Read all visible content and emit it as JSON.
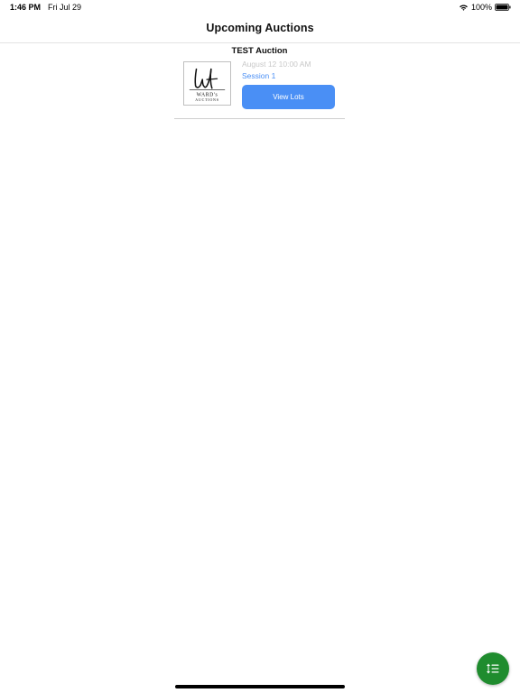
{
  "status_bar": {
    "time": "1:46 PM",
    "date": "Fri Jul 29",
    "battery": "100%",
    "icons": [
      "wifi-icon",
      "battery-icon"
    ]
  },
  "nav": {
    "title": "Upcoming Auctions"
  },
  "auctions": [
    {
      "title": "TEST Auction",
      "logo_icon": "wards-auctions-logo",
      "logo_text": "WARD's AUCTIONS",
      "date": "August 12 10:00 AM",
      "session": "Session 1",
      "button_label": "View Lots"
    }
  ],
  "fab": {
    "icon": "sort-list-icon",
    "color": "#1f8c2e"
  },
  "colors": {
    "accent": "#4a8ff5",
    "muted": "#c8c8c8"
  }
}
